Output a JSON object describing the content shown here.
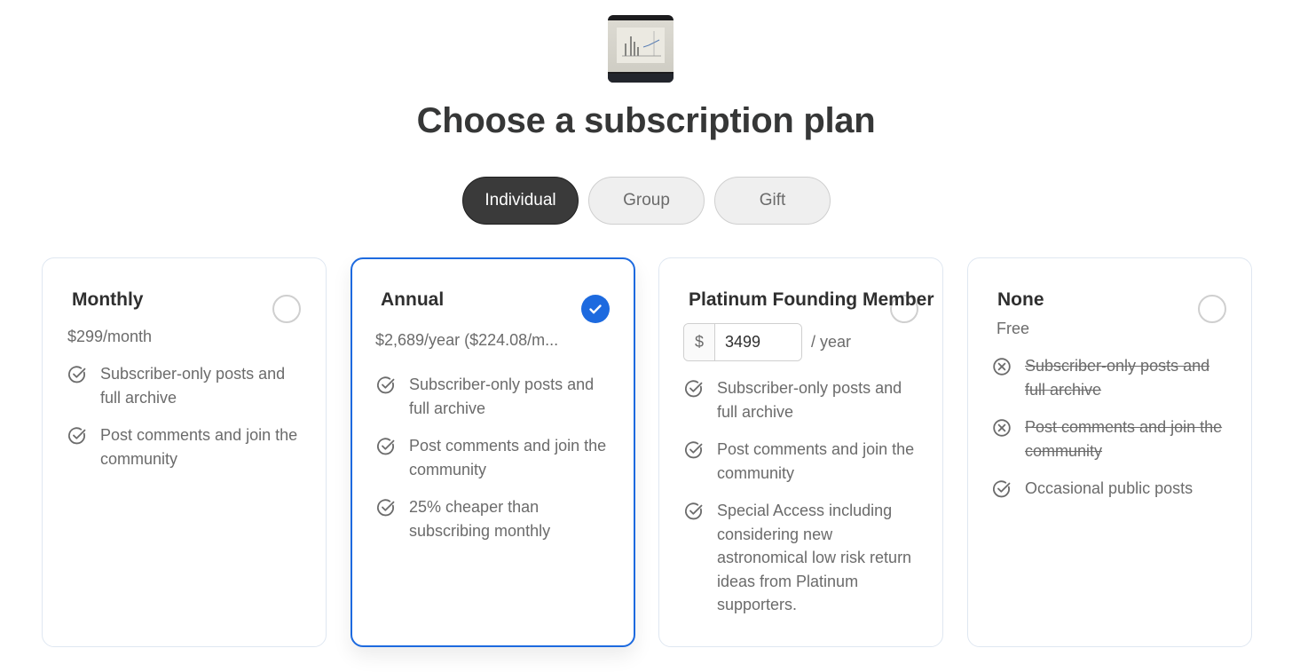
{
  "header": {
    "logo_name": "publication-logo",
    "title": "Choose a subscription plan"
  },
  "tabs": [
    {
      "label": "Individual",
      "active": true
    },
    {
      "label": "Group",
      "active": false
    },
    {
      "label": "Gift",
      "active": false
    }
  ],
  "plans": [
    {
      "title": "Monthly",
      "price": "$299/month",
      "selected": false,
      "features": [
        {
          "text": "Subscriber-only posts and full archive",
          "included": true
        },
        {
          "text": "Post comments and join the community",
          "included": true
        }
      ]
    },
    {
      "title": "Annual",
      "price": "$2,689/year ($224.08/m...",
      "selected": true,
      "features": [
        {
          "text": "Subscriber-only posts and full archive",
          "included": true
        },
        {
          "text": "Post comments and join the community",
          "included": true
        },
        {
          "text": "25% cheaper than subscribing monthly",
          "included": true
        }
      ]
    },
    {
      "title": "Platinum Founding Member",
      "selected": false,
      "amount": {
        "prefix": "$",
        "value": "3499",
        "suffix": "/ year"
      },
      "features": [
        {
          "text": "Subscriber-only posts and full archive",
          "included": true
        },
        {
          "text": "Post comments and join the community",
          "included": true
        },
        {
          "text": "Special Access including considering new astronomical low risk return ideas from Platinum supporters.",
          "included": true
        }
      ]
    },
    {
      "title": "None",
      "price": "Free",
      "selected": false,
      "features": [
        {
          "text": "Subscriber-only posts and full archive",
          "included": false
        },
        {
          "text": "Post comments and join the community",
          "included": false
        },
        {
          "text": "Occasional public posts",
          "included": true
        }
      ]
    }
  ],
  "colors": {
    "accent": "#1d6adf",
    "active_tab": "#3a3a3a",
    "muted_text": "#6b6b6b",
    "title_text": "#363737"
  },
  "icons": {
    "included": "check-circle-icon",
    "excluded": "x-circle-icon",
    "selected": "checkmark-icon"
  }
}
